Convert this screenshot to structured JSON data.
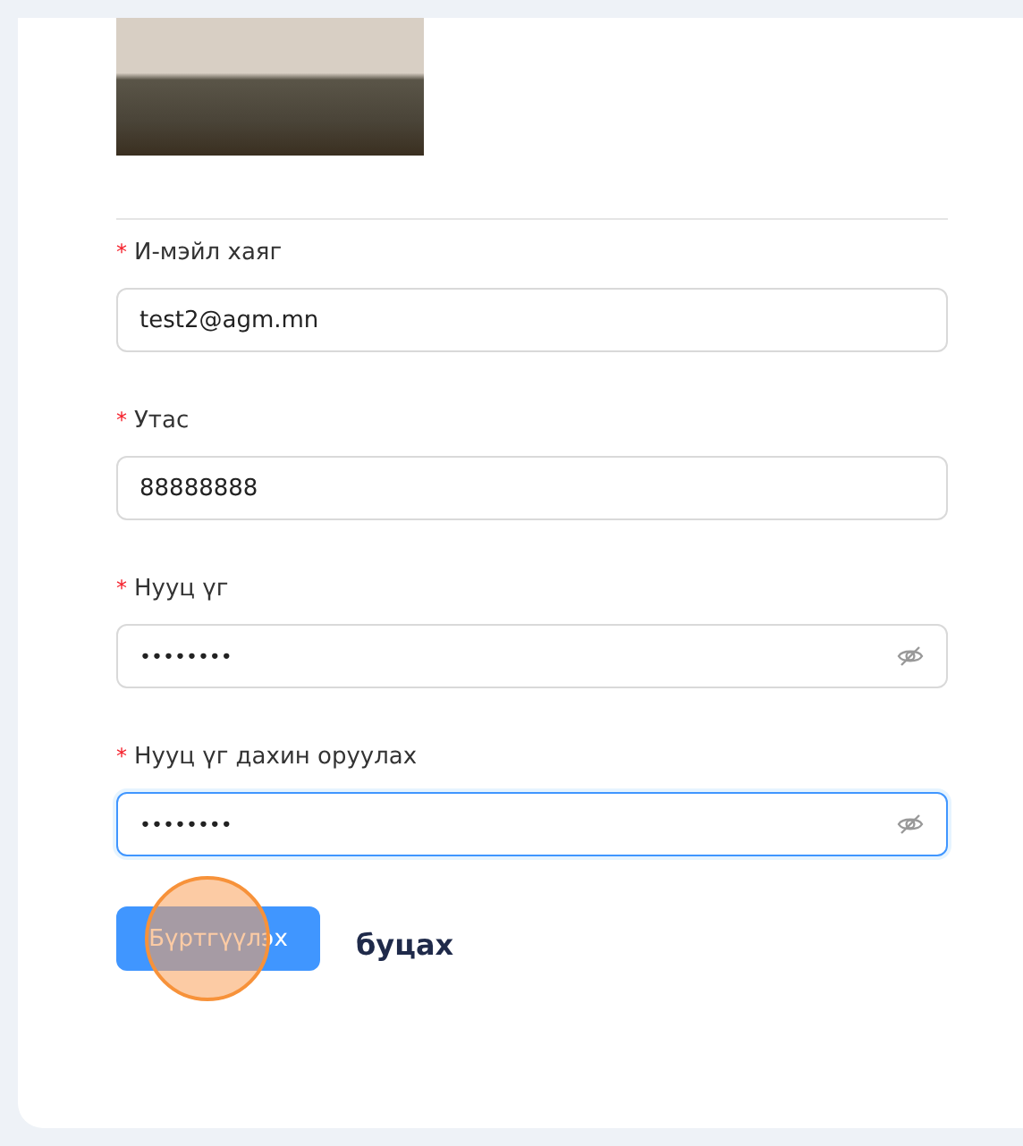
{
  "fields": [
    {
      "label": "И-мэйл хаяг",
      "required_mark": "*",
      "kind": "text",
      "value": "test2@agm.mn",
      "focused": false
    },
    {
      "label": "Утас",
      "required_mark": "*",
      "kind": "text",
      "value": "88888888",
      "focused": false
    },
    {
      "label": "Нууц үг",
      "required_mark": "*",
      "kind": "password",
      "value": "••••••••",
      "focused": false
    },
    {
      "label": "Нууц үг дахин оруулах",
      "required_mark": "*",
      "kind": "password",
      "value": "••••••••",
      "focused": true
    }
  ],
  "submit_button": {
    "label": "Бүртгүүлэх",
    "click_highlight": true
  },
  "back_link": {
    "label": "буцах"
  }
}
